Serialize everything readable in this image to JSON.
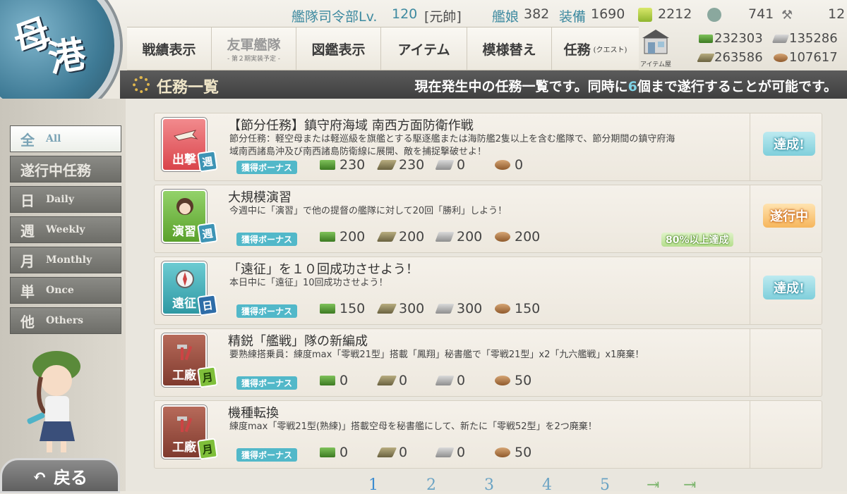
{
  "emblem": {
    "char1": "母",
    "char2": "港"
  },
  "hud": {
    "hq_label": "艦隊司令部Lv.",
    "hq_level": "120",
    "rank": "[元帥]",
    "ship_label": "艦娘",
    "ship_count": "382",
    "equip_label": "装備",
    "equip_count": "1690",
    "bucket": "2212",
    "devmat": "741",
    "screw": "12"
  },
  "menu": {
    "items": [
      {
        "label": "戦績表示",
        "sub": ""
      },
      {
        "label": "友軍艦隊",
        "sub": "- 第２期実装予定 -"
      },
      {
        "label": "図鑑表示",
        "sub": ""
      },
      {
        "label": "アイテム",
        "sub": ""
      },
      {
        "label": "模様替え",
        "sub": ""
      },
      {
        "label": "任務",
        "sub": "(クエスト)"
      }
    ],
    "shop_label": "アイテム屋"
  },
  "resources": {
    "fuel": "232303",
    "steel": "135286",
    "ammo": "263586",
    "bauxite": "107617"
  },
  "titlebar": {
    "title": "任務一覧",
    "info_before": "現在発生中の任務一覧です。同時に",
    "info_count": "6",
    "info_after": "個まで遂行することが可能です。"
  },
  "sidebar": {
    "tabs": [
      {
        "kanji": "全",
        "label": "All"
      },
      {
        "kanji": "遂行中任務",
        "label": ""
      },
      {
        "kanji": "日",
        "label": "Daily"
      },
      {
        "kanji": "週",
        "label": "Weekly"
      },
      {
        "kanji": "月",
        "label": "Monthly"
      },
      {
        "kanji": "単",
        "label": "Once"
      },
      {
        "kanji": "他",
        "label": "Others"
      }
    ],
    "back_label": "戻る"
  },
  "quests": [
    {
      "category": "出撃",
      "freq": "週",
      "title": "【節分任務】鎮守府海域 南西方面防衛作戦",
      "desc": "節分任務：軽空母または軽巡級を旗艦とする駆逐艦または海防艦2隻以上を含む艦隊で、節分期間の鎮守府海域南西諸島沖及び南西諸島防衛線に展開、敵を捕捉撃破せよ！",
      "bonus": "獲得ボーナス",
      "fuel": "230",
      "ammo": "230",
      "steel": "0",
      "bauxite": "0",
      "status": "達成!",
      "progress": ""
    },
    {
      "category": "演習",
      "freq": "週",
      "title": "大規模演習",
      "desc": "今週中に「演習」で他の提督の艦隊に対して20回「勝利」しよう！",
      "bonus": "獲得ボーナス",
      "fuel": "200",
      "ammo": "200",
      "steel": "200",
      "bauxite": "200",
      "status": "遂行中",
      "progress": "80%以上達成"
    },
    {
      "category": "遠征",
      "freq": "日",
      "title": "「遠征」を１０回成功させよう！",
      "desc": "本日中に「遠征」10回成功させよう！",
      "bonus": "獲得ボーナス",
      "fuel": "150",
      "ammo": "300",
      "steel": "300",
      "bauxite": "150",
      "status": "達成!",
      "progress": ""
    },
    {
      "category": "工廠",
      "freq": "月",
      "title": "精鋭「艦戦」隊の新編成",
      "desc": "要熟練搭乗員：練度max「零戦21型」搭載「鳳翔」秘書艦で「零戦21型」x2「九六艦戦」x1廃棄！",
      "bonus": "獲得ボーナス",
      "fuel": "0",
      "ammo": "0",
      "steel": "0",
      "bauxite": "50",
      "status": "",
      "progress": ""
    },
    {
      "category": "工廠",
      "freq": "月",
      "title": "機種転換",
      "desc": "練度max「零戦21型(熟練)」搭載空母を秘書艦にして、新たに「零戦52型」を2つ廃棄！",
      "bonus": "獲得ボーナス",
      "fuel": "0",
      "ammo": "0",
      "steel": "0",
      "bauxite": "50",
      "status": "",
      "progress": ""
    }
  ],
  "pager": {
    "pages": [
      "1",
      "2",
      "3",
      "4",
      "5"
    ],
    "next": "⇥",
    "last": "⇥"
  },
  "colors": {
    "sortie": "#e2545a",
    "exercise": "#6cb83a",
    "expedition": "#3aa7b0",
    "arsenal": "#9a4a3c",
    "accent": "#6aa3c4"
  }
}
